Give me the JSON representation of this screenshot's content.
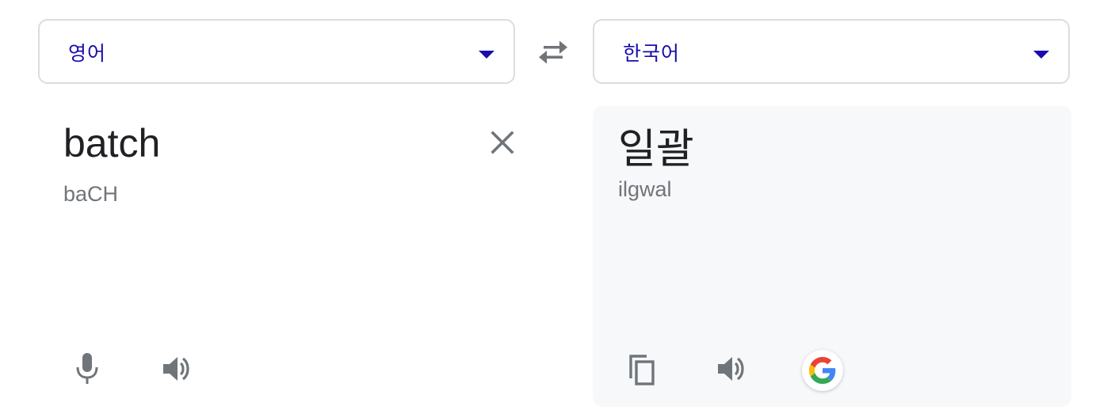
{
  "source_language": {
    "label": "영어"
  },
  "target_language": {
    "label": "한국어"
  },
  "source": {
    "text": "batch",
    "transliteration": "baCH"
  },
  "target": {
    "text": "일괄",
    "transliteration": "ilgwal"
  },
  "icons": {
    "swap": "swap-arrows-icon",
    "clear": "close-icon",
    "mic": "microphone-icon",
    "source_speaker": "speaker-icon",
    "copy": "copy-icon",
    "target_speaker": "speaker-icon",
    "google": "google-logo-icon"
  },
  "colors": {
    "accent": "#1a0dab",
    "icon_gray": "#70757a",
    "panel_bg": "#f7f8fa",
    "border": "#dadce0"
  }
}
